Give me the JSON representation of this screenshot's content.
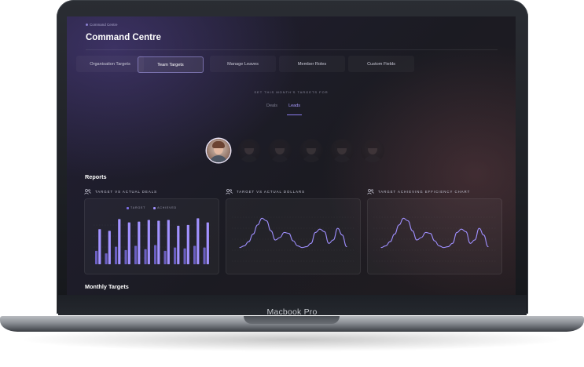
{
  "device": {
    "model_label": "Macbook Pro"
  },
  "app": {
    "breadcrumb": "Command Centre",
    "title": "Command Centre",
    "tabs": [
      {
        "label": "Organisation Targets",
        "active": false
      },
      {
        "label": "Team Targets",
        "active": true
      },
      {
        "label": "Manage Leaves",
        "active": false
      },
      {
        "label": "Member Roles",
        "active": false
      },
      {
        "label": "Custom Fields",
        "active": false
      }
    ],
    "targets_caption": "SET THIS MONTH'S TARGETS FOR",
    "target_types": [
      {
        "label": "Deals",
        "selected": false
      },
      {
        "label": "Leads",
        "selected": true
      }
    ],
    "team_members_count": 6,
    "reports_title": "Reports",
    "monthly_title": "Monthly Targets",
    "colors": {
      "accent": "#8c7cf0",
      "target": "#7d6ee6",
      "achieved": "#a292ff"
    }
  },
  "chart_data": [
    {
      "type": "bar",
      "title": "TARGET VS ACTUAL DEALS",
      "icon": "users-icon",
      "legend": [
        "TARGET",
        "ACHIEVED"
      ],
      "legend_position": "top-center",
      "series": [
        {
          "name": "TARGET",
          "values": [
            16,
            13,
            21,
            17,
            22,
            18,
            23,
            16,
            20,
            19,
            22,
            20
          ]
        },
        {
          "name": "ACHIEVED",
          "values": [
            42,
            40,
            54,
            50,
            51,
            53,
            52,
            53,
            46,
            47,
            55,
            50
          ]
        }
      ],
      "ylim": [
        0,
        60
      ],
      "grid": true
    },
    {
      "type": "line",
      "title": "TARGET VS ACTUAL DOLLARS",
      "icon": "users-icon",
      "x": [
        0,
        1,
        2,
        3,
        4,
        5,
        6,
        7,
        8,
        9,
        10,
        11,
        12,
        13,
        14,
        15,
        16,
        17,
        18,
        19,
        20,
        21,
        22,
        23,
        24
      ],
      "series": [
        {
          "values": [
            20,
            22,
            27,
            36,
            47,
            55,
            52,
            40,
            29,
            32,
            38,
            37,
            28,
            22,
            20,
            21,
            25,
            38,
            42,
            39,
            25,
            29,
            43,
            35,
            21
          ]
        }
      ],
      "ylim": [
        0,
        60
      ],
      "grid": true
    },
    {
      "type": "line",
      "title": "TARGET ACHIEVING EFFICIENCY CHART",
      "icon": "users-icon",
      "x": [
        0,
        1,
        2,
        3,
        4,
        5,
        6,
        7,
        8,
        9,
        10,
        11,
        12,
        13,
        14,
        15,
        16,
        17,
        18,
        19,
        20,
        21,
        22,
        23,
        24
      ],
      "series": [
        {
          "values": [
            20,
            22,
            27,
            36,
            47,
            55,
            52,
            40,
            29,
            32,
            38,
            37,
            28,
            22,
            20,
            21,
            25,
            38,
            42,
            39,
            25,
            29,
            43,
            35,
            21
          ]
        }
      ],
      "ylim": [
        0,
        60
      ],
      "grid": true
    }
  ]
}
